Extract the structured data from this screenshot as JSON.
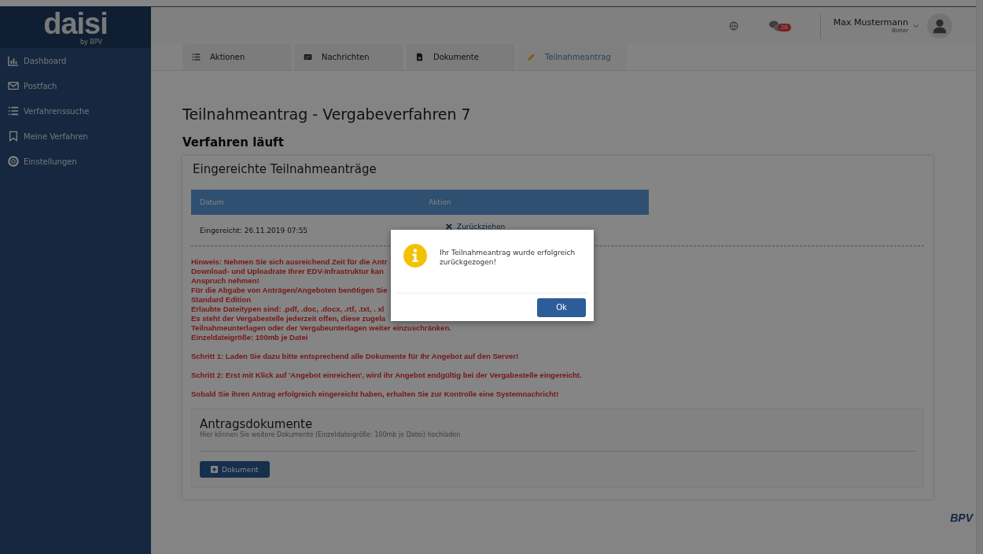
{
  "sidebar": {
    "logo": "daisi",
    "logo_sub": "by BPV",
    "items": [
      {
        "label": "Dashboard",
        "selected": false
      },
      {
        "label": "Postfach",
        "selected": false
      },
      {
        "label": "Verfahrenssuche",
        "selected": false
      },
      {
        "label": "Meine Verfahren",
        "selected": false
      },
      {
        "label": "Einstellungen",
        "selected": false
      }
    ]
  },
  "header": {
    "message_count": "20",
    "user_name": "Max Mustermann",
    "user_role": "Bieter"
  },
  "tabs": [
    {
      "label": "Aktionen",
      "selected": false
    },
    {
      "label": "Nachrichten",
      "selected": false
    },
    {
      "label": "Dokumente",
      "selected": false
    },
    {
      "label": "Teilnahmeantrag",
      "selected": true
    }
  ],
  "page_title": "Teilnahmeantrag - Vergabeverfahren 7",
  "status": "Verfahren läuft",
  "submissions": {
    "title": "Eingereichte Teilnahmeanträge",
    "columns": [
      "Datum",
      "Aktion"
    ],
    "rows": [
      {
        "date": "Eingereicht: 26.11.2019 07:55",
        "action": "Zurückziehen"
      }
    ]
  },
  "notice_lines": [
    "Hinweis: Nehmen Sie sich ausreichend Zeit für die Antr",
    "Download- und Uploadrate Ihrer EDV-Infrastruktur kan",
    "Anspruch nehmen!",
    "Für die Abgabe von Anträgen/Angeboten benötigen Sie",
    "Standard Edition",
    "Erlaubte Dateitypen sind: .pdf, .doc, .docx, .rtf, .txt, . xl",
    "Es steht der Vergabestelle jederzeit offen, diese zugela",
    "Teilnahmeunterlagen oder der Vergabeunterlagen weiter einzuschränken.",
    "Einzeldateigröße: 100mb je Datei"
  ],
  "steps": [
    "Schritt 1: Laden Sie dazu bitte entsprechend alle Dokumente für Ihr Angebot auf den Server!",
    "Schritt 2: Erst mit Klick auf 'Angebot einreichen', wird ihr Angebot endgültig bei der Vergabestelle eingereicht.",
    "Sobald Sie ihren Antrag erfolgreich eingereicht haben, erhalten Sie zur Kontrolle eine Systemnachricht!"
  ],
  "documents": {
    "title": "Antragsdokumente",
    "hint": "Hier können Sie weitere Dokumente (Einzeldateigröße: 100mb je Datei) hochladen",
    "button": "Dokument"
  },
  "footer_logo": "BPV",
  "dialog": {
    "message": "Ihr Teilnahmeantrag wurde erfolgreich zurückgezogen!",
    "button": "Ok"
  }
}
